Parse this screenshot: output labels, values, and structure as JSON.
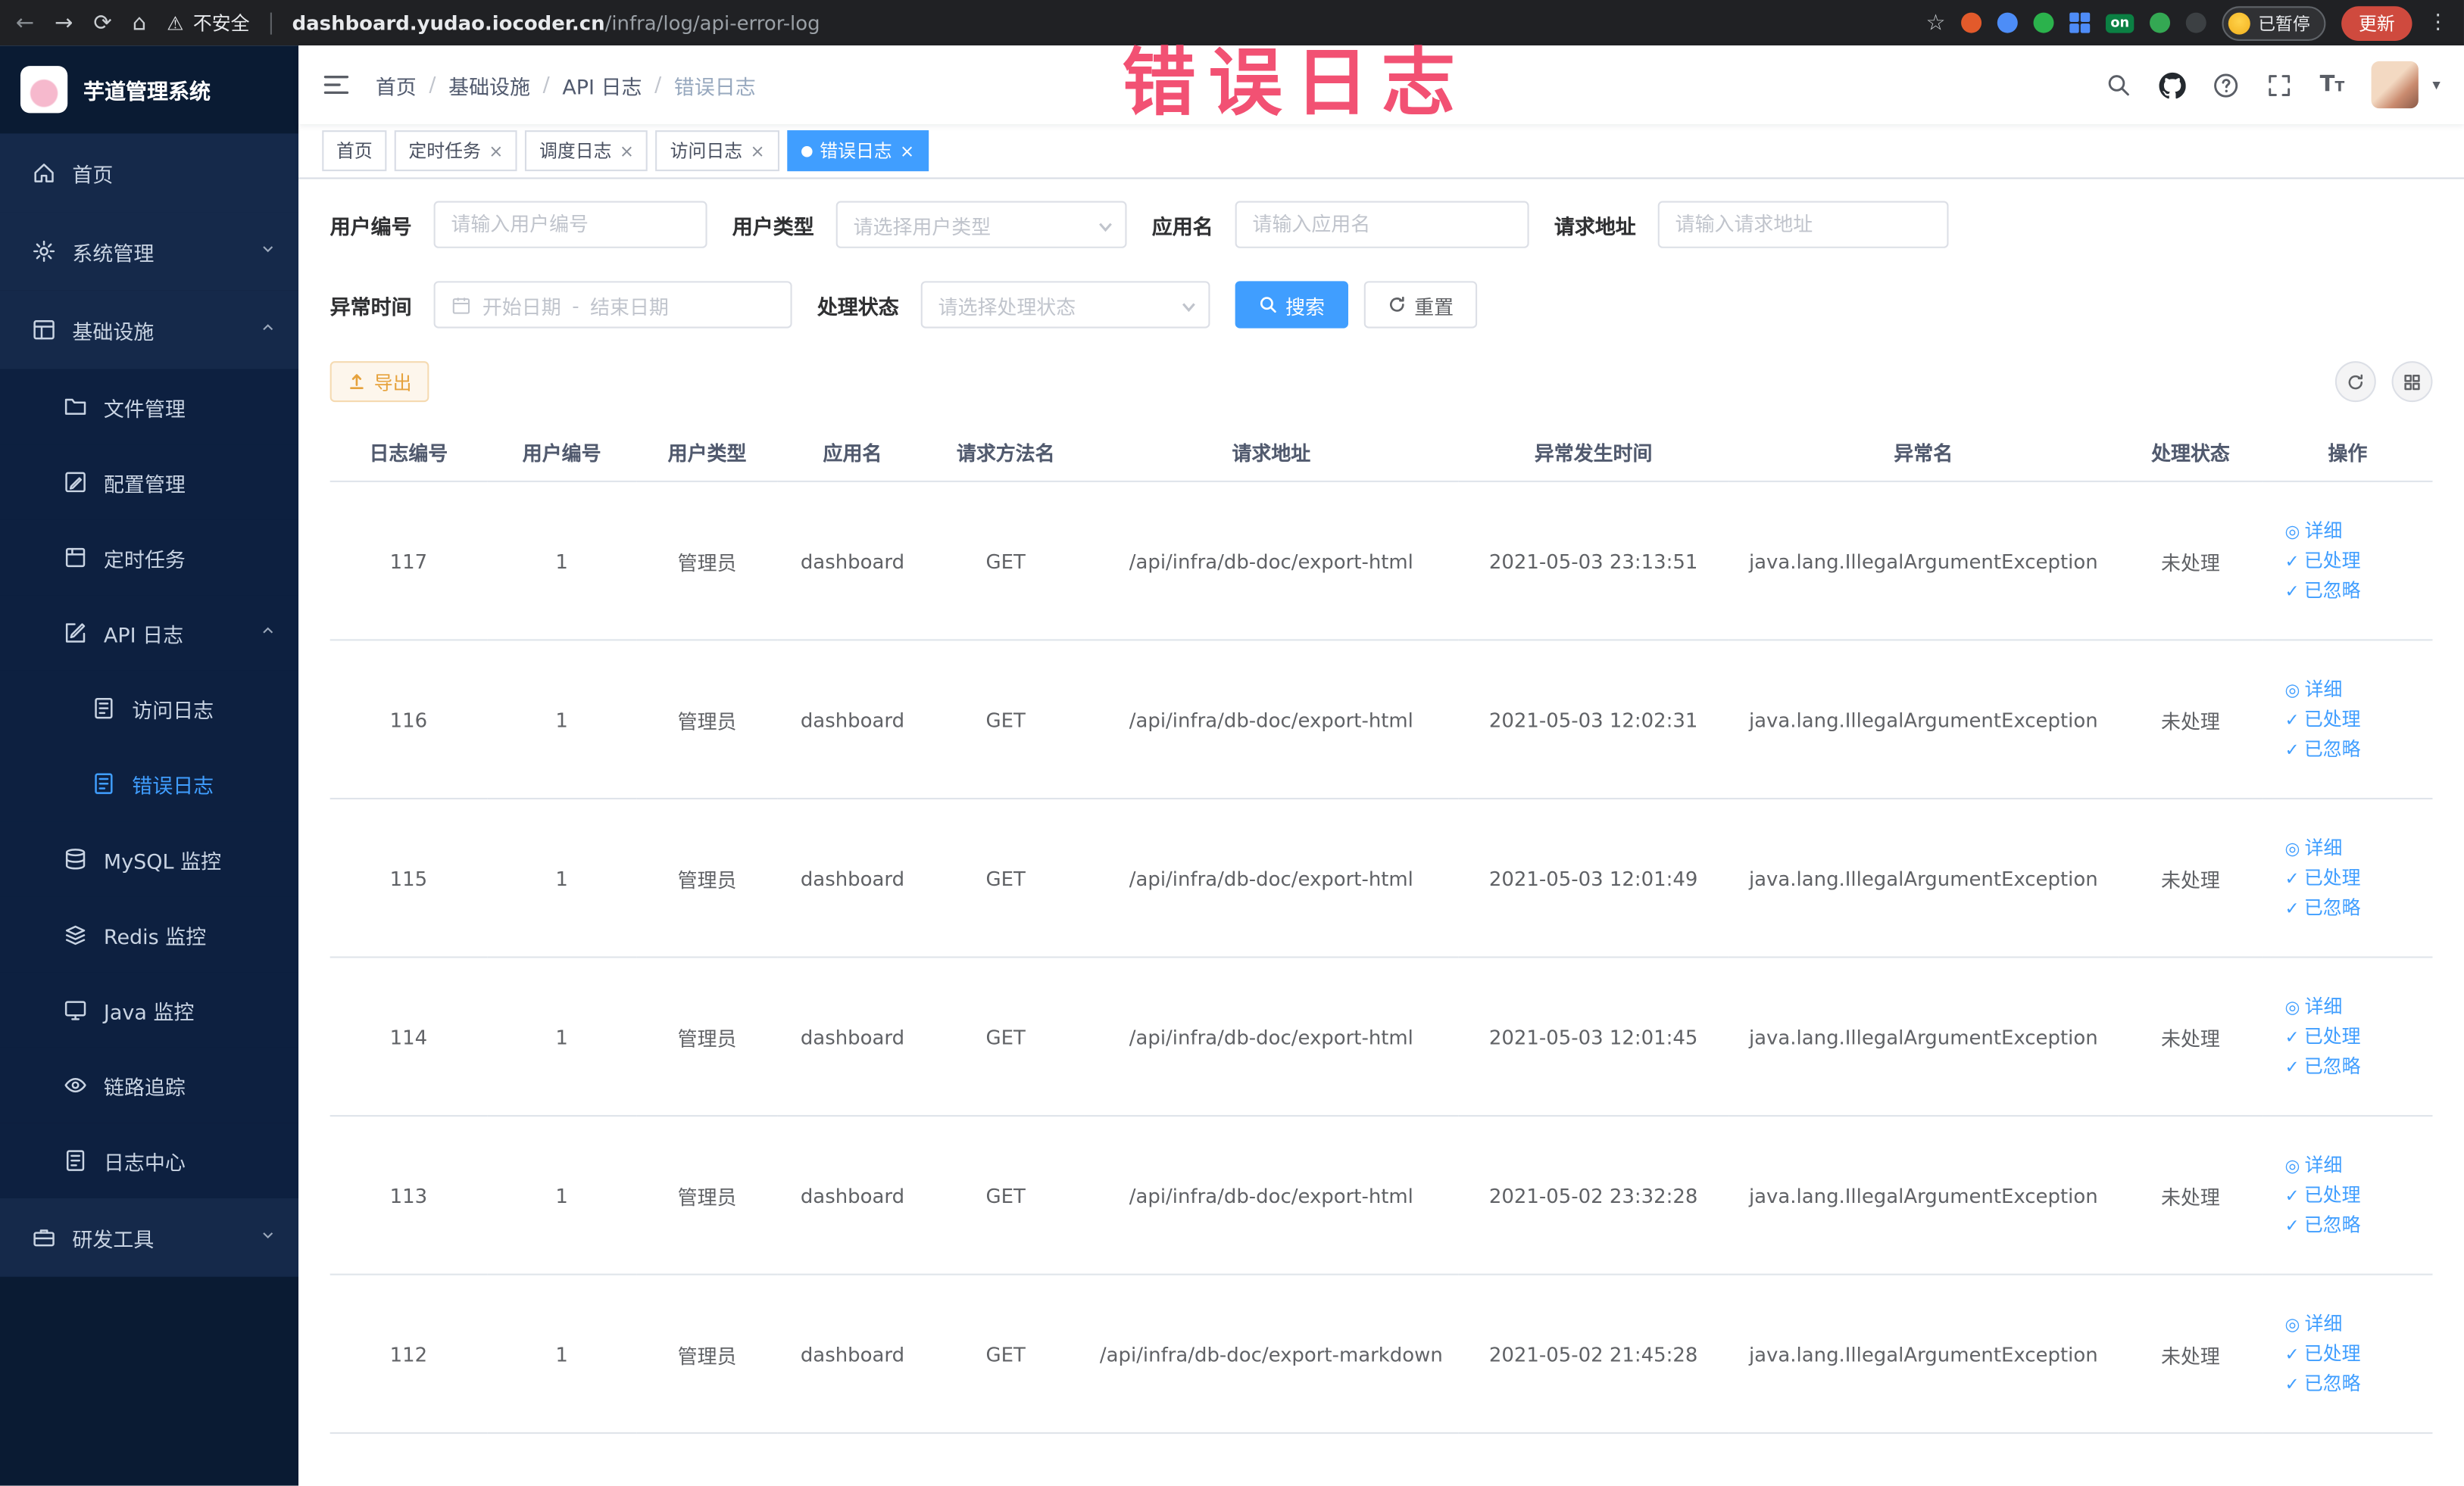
{
  "colors": {
    "accent": "#409eff",
    "annotation": "#f13e64",
    "warning": "#e6a23c",
    "sidebar": "#15294a"
  },
  "browser": {
    "not_secure": "不安全",
    "url_host": "dashboard.yudao.iocoder.cn",
    "url_path": "/infra/log/api-error-log",
    "ext_on_badge": "on",
    "paused_badge": "已暂停",
    "update_button": "更新"
  },
  "annotation": {
    "text": "错误日志"
  },
  "sidebar": {
    "logo_title": "芋道管理系统",
    "items": [
      {
        "label": "首页"
      },
      {
        "label": "系统管理"
      },
      {
        "label": "基础设施"
      },
      {
        "label": "文件管理"
      },
      {
        "label": "配置管理"
      },
      {
        "label": "定时任务"
      },
      {
        "label": "API 日志"
      },
      {
        "label": "访问日志"
      },
      {
        "label": "错误日志"
      },
      {
        "label": "MySQL 监控"
      },
      {
        "label": "Redis 监控"
      },
      {
        "label": "Java 监控"
      },
      {
        "label": "链路追踪"
      },
      {
        "label": "日志中心"
      },
      {
        "label": "研发工具"
      }
    ]
  },
  "breadcrumb": {
    "items": [
      "首页",
      "基础设施",
      "API 日志",
      "错误日志"
    ]
  },
  "tabs": [
    {
      "label": "首页"
    },
    {
      "label": "定时任务"
    },
    {
      "label": "调度日志"
    },
    {
      "label": "访问日志"
    },
    {
      "label": "错误日志"
    }
  ],
  "filters": {
    "user_id": {
      "label": "用户编号",
      "placeholder": "请输入用户编号"
    },
    "user_type": {
      "label": "用户类型",
      "placeholder": "请选择用户类型"
    },
    "app_name": {
      "label": "应用名",
      "placeholder": "请输入应用名"
    },
    "request_url": {
      "label": "请求地址",
      "placeholder": "请输入请求地址"
    },
    "exception_time": {
      "label": "异常时间",
      "start_placeholder": "开始日期",
      "separator": "-",
      "end_placeholder": "结束日期"
    },
    "process_status": {
      "label": "处理状态",
      "placeholder": "请选择处理状态"
    },
    "search_button": "搜索",
    "reset_button": "重置"
  },
  "toolbar": {
    "export_button": "导出"
  },
  "table": {
    "columns": [
      "日志编号",
      "用户编号",
      "用户类型",
      "应用名",
      "请求方法名",
      "请求地址",
      "异常发生时间",
      "异常名",
      "处理状态",
      "操作"
    ],
    "actions": [
      "详细",
      "已处理",
      "已忽略"
    ],
    "rows": [
      {
        "id": "117",
        "user_id": "1",
        "user_type": "管理员",
        "app": "dashboard",
        "method": "GET",
        "url": "/api/infra/db-doc/export-html",
        "time": "2021-05-03 23:13:51",
        "exception": "java.lang.IllegalArgumentException",
        "status": "未处理"
      },
      {
        "id": "116",
        "user_id": "1",
        "user_type": "管理员",
        "app": "dashboard",
        "method": "GET",
        "url": "/api/infra/db-doc/export-html",
        "time": "2021-05-03 12:02:31",
        "exception": "java.lang.IllegalArgumentException",
        "status": "未处理"
      },
      {
        "id": "115",
        "user_id": "1",
        "user_type": "管理员",
        "app": "dashboard",
        "method": "GET",
        "url": "/api/infra/db-doc/export-html",
        "time": "2021-05-03 12:01:49",
        "exception": "java.lang.IllegalArgumentException",
        "status": "未处理"
      },
      {
        "id": "114",
        "user_id": "1",
        "user_type": "管理员",
        "app": "dashboard",
        "method": "GET",
        "url": "/api/infra/db-doc/export-html",
        "time": "2021-05-03 12:01:45",
        "exception": "java.lang.IllegalArgumentException",
        "status": "未处理"
      },
      {
        "id": "113",
        "user_id": "1",
        "user_type": "管理员",
        "app": "dashboard",
        "method": "GET",
        "url": "/api/infra/db-doc/export-html",
        "time": "2021-05-02 23:32:28",
        "exception": "java.lang.IllegalArgumentException",
        "status": "未处理"
      },
      {
        "id": "112",
        "user_id": "1",
        "user_type": "管理员",
        "app": "dashboard",
        "method": "GET",
        "url": "/api/infra/db-doc/export-markdown",
        "time": "2021-05-02 21:45:28",
        "exception": "java.lang.IllegalArgumentException",
        "status": "未处理"
      }
    ]
  }
}
